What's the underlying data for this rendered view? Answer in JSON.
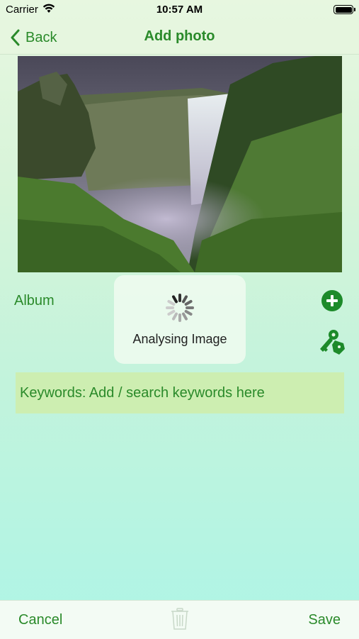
{
  "status_bar": {
    "carrier": "Carrier",
    "time": "10:57 AM"
  },
  "nav": {
    "back_label": "Back",
    "title": "Add photo"
  },
  "form": {
    "album_label": "Album",
    "keywords_placeholder": "Keywords: Add / search keywords here"
  },
  "hud": {
    "label": "Analysing Image"
  },
  "toolbar": {
    "cancel_label": "Cancel",
    "save_label": "Save"
  },
  "icons": {
    "back": "chevron-left-icon",
    "add_album": "plus-circle-icon",
    "keywords": "keys-tag-icon",
    "delete": "trash-icon",
    "loading": "spinner-icon"
  },
  "colors": {
    "accent": "#2a8a2a",
    "keywords_bg": "#cdeeb1"
  }
}
